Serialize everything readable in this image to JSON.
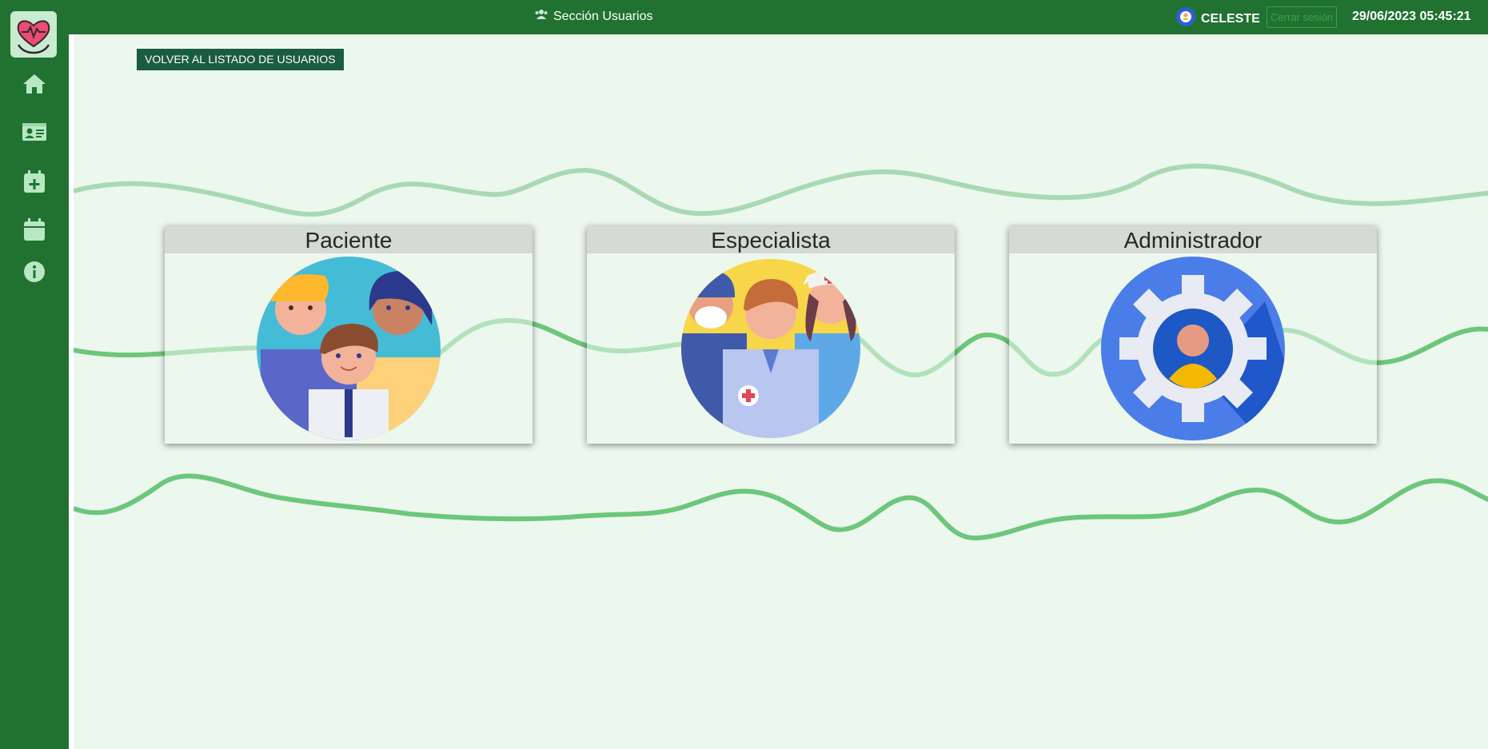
{
  "sidebar": {
    "logo": "heart-hands-logo",
    "items": [
      {
        "icon": "home-icon"
      },
      {
        "icon": "id-card-icon"
      },
      {
        "icon": "calendar-plus-icon"
      },
      {
        "icon": "calendar-icon"
      },
      {
        "icon": "info-icon"
      }
    ]
  },
  "header": {
    "section_title": "Sección Usuarios",
    "user_name": "CELESTE",
    "logout_label": "Cerrar sesión",
    "datetime": "29/06/2023 05:45:21"
  },
  "main": {
    "back_button_label": "VOLVER AL LISTADO DE USUARIOS",
    "cards": [
      {
        "title": "Paciente",
        "icon": "patients-illustration"
      },
      {
        "title": "Especialista",
        "icon": "medical-staff-illustration"
      },
      {
        "title": "Administrador",
        "icon": "admin-gear-illustration"
      }
    ]
  },
  "colors": {
    "sidebar": "#217230",
    "background": "#ecf7ee",
    "wave": "#4fbd5f",
    "accent_button": "#1a5c3e"
  }
}
